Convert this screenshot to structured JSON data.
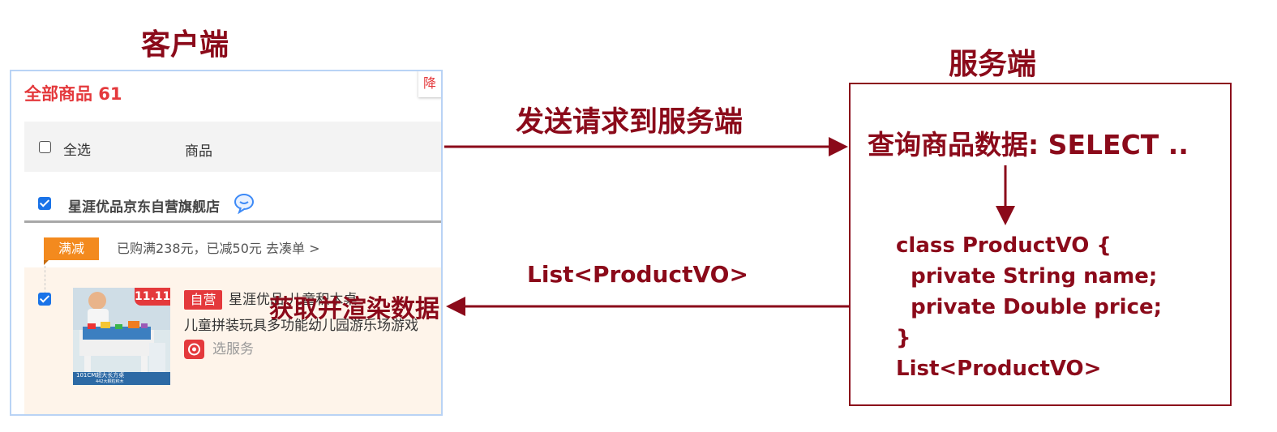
{
  "labels": {
    "client_title": "客户端",
    "server_title": "服务端",
    "send_request": "发送请求到服务端",
    "response_type": "List<ProductVO>",
    "fetch_render": "获取并渲染数据"
  },
  "client": {
    "all_goods": "全部商品 61",
    "corner_tag": "降",
    "header": {
      "select_all": "全选",
      "goods_column": "商品"
    },
    "shop": {
      "name": "星涯优品京东自营旗舰店"
    },
    "promo": {
      "tag": "满减",
      "text": "已购满238元，已减50元 去凑单 >"
    },
    "item": {
      "self_operated": "自营",
      "title_line1": "星涯优品 儿童积木桌",
      "title_line2": "儿童拼装玩具多功能幼儿园游乐场游戏",
      "service": "选服务",
      "thumb_promo": "11.11",
      "thumb_caption1": "101CM超大长方桌",
      "thumb_caption2": "442大颗粒积木"
    }
  },
  "server": {
    "query": "查询商品数据: SELECT ..",
    "code_lines": [
      "class ProductVO {",
      "  private String name;",
      "  private Double price;",
      "}",
      "List<ProductVO>"
    ]
  },
  "colors": {
    "accent": "#8b0a1a",
    "jd_red": "#e4393c",
    "promo_orange": "#f38a1e",
    "checkbox_blue": "#1a73e8"
  }
}
